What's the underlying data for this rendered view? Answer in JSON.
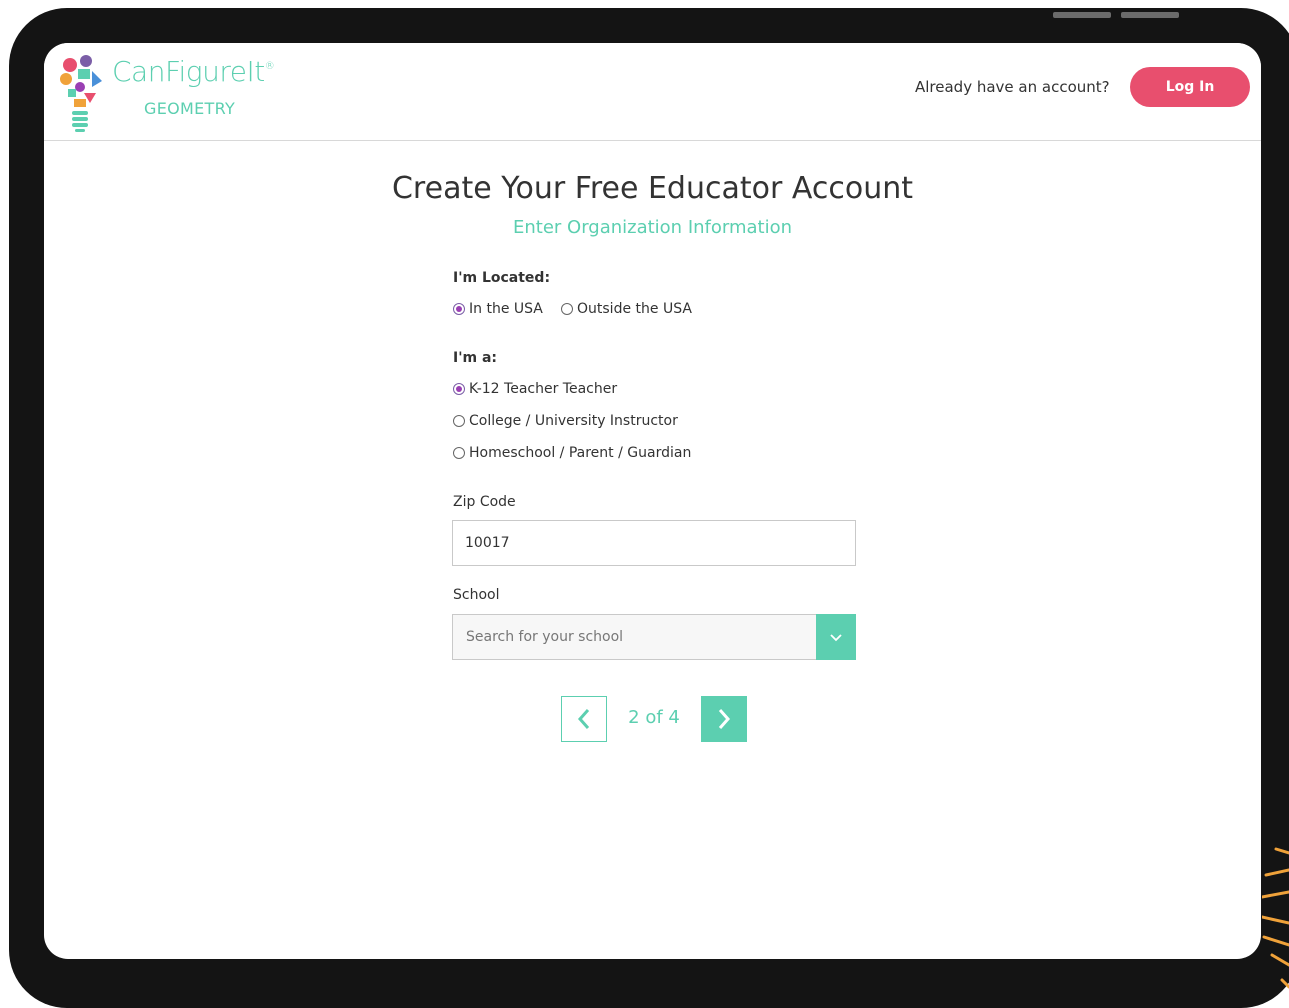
{
  "brand": {
    "name": "CanFigureIt",
    "trademark": "®",
    "product": "GEOMETRY"
  },
  "header": {
    "already_text": "Already have an account?",
    "login_label": "Log In"
  },
  "form": {
    "title": "Create Your Free Educator Account",
    "subtitle": "Enter Organization Information",
    "location": {
      "label": "I'm Located:",
      "options": [
        {
          "label": "In the USA",
          "checked": true
        },
        {
          "label": "Outside the USA",
          "checked": false
        }
      ]
    },
    "role": {
      "label": "I'm a:",
      "options": [
        {
          "label": "K-12 Teacher Teacher",
          "checked": true
        },
        {
          "label": "College / University Instructor",
          "checked": false
        },
        {
          "label": "Homeschool / Parent / Guardian",
          "checked": false
        }
      ]
    },
    "zip": {
      "label": "Zip Code",
      "value": "10017"
    },
    "school": {
      "label": "School",
      "placeholder": "Search for your school"
    }
  },
  "pagination": {
    "text": "2 of 4",
    "current": 2,
    "total": 4
  },
  "colors": {
    "accent": "#5ccfb0",
    "login": "#e84f6e",
    "radio_checked": "#9a3fb3",
    "device": "#141414",
    "decoration": "#f0a23a"
  },
  "icons": {
    "prev": "chevron-left-icon",
    "next": "chevron-right-icon",
    "dropdown": "chevron-down-icon"
  }
}
